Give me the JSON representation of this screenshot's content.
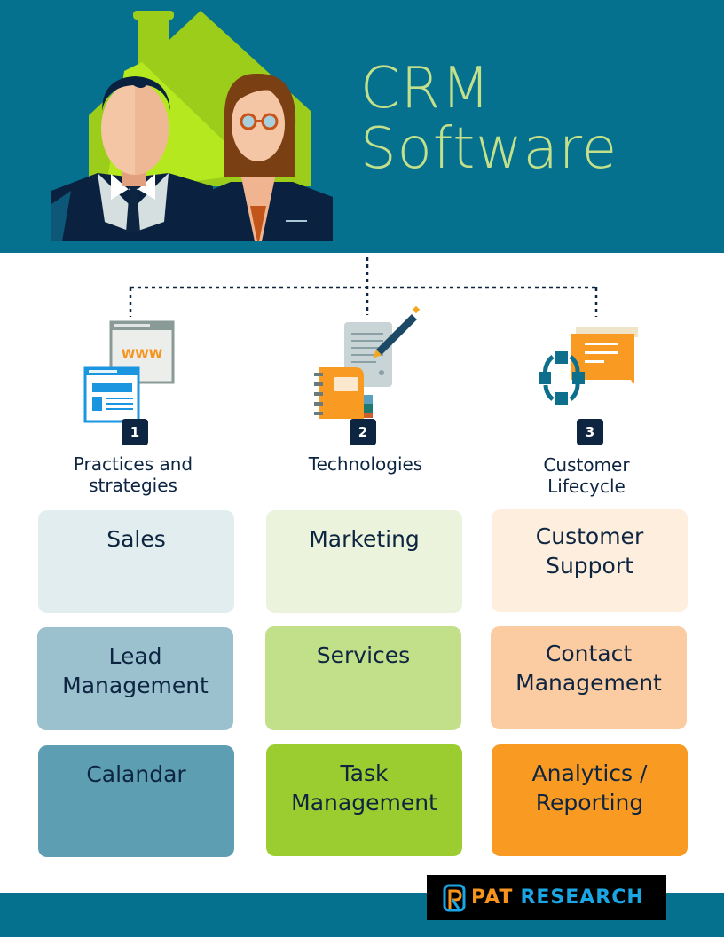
{
  "header": {
    "title_line1": "CRM",
    "title_line2": "Software",
    "illustration": "business-people-house-illustration",
    "colors": {
      "background": "#06708f",
      "title": "#c3e08a",
      "house": "#9ccd1a"
    }
  },
  "categories": [
    {
      "number": "1",
      "label_line1": "Practices and",
      "label_line2": "strategies",
      "icon": "browser-windows-icon"
    },
    {
      "number": "2",
      "label_line1": "Technologies",
      "label_line2": "",
      "icon": "notebook-document-pen-icon"
    },
    {
      "number": "3",
      "label_line1": "Customer",
      "label_line2": "Lifecycle",
      "icon": "cycle-chat-bubble-icon"
    }
  ],
  "columns": [
    {
      "cards": [
        {
          "line1": "Sales",
          "line2": "",
          "color": "#e2edef"
        },
        {
          "line1": "Lead",
          "line2": "Management",
          "color": "#9bc1cf"
        },
        {
          "line1": "Calandar",
          "line2": "",
          "color": "#5e9eb2"
        }
      ]
    },
    {
      "cards": [
        {
          "line1": "Marketing",
          "line2": "",
          "color": "#ebf3dc"
        },
        {
          "line1": "Services",
          "line2": "",
          "color": "#c2e08a"
        },
        {
          "line1": "Task",
          "line2": "Management",
          "color": "#9ccd30"
        }
      ]
    },
    {
      "cards": [
        {
          "line1": "Customer",
          "line2": "Support",
          "color": "#fdeede"
        },
        {
          "line1": "Contact",
          "line2": "Management",
          "color": "#fbcba2"
        },
        {
          "line1": "Analytics /",
          "line2": "Reporting",
          "color": "#f99b22"
        }
      ]
    }
  ],
  "footer": {
    "brand_part1": "PAT",
    "brand_part2": "RESEARCH",
    "brand_icon": "pat-research-logo-icon"
  }
}
